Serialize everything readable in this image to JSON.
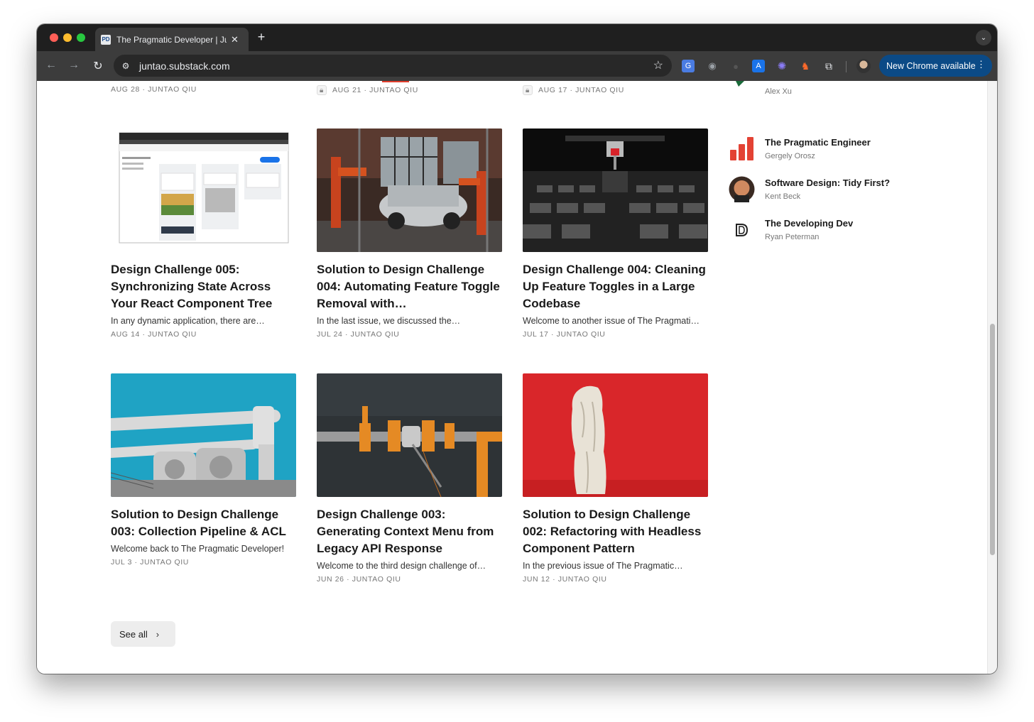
{
  "browser": {
    "tab_title": "The Pragmatic Developer | Ju",
    "tab_favicon": "PD",
    "url": "juntao.substack.com",
    "update_label": "New Chrome available"
  },
  "top_row": [
    {
      "meta": "AUG 28 · JUNTAO QIU",
      "locked": false
    },
    {
      "meta": "AUG 21 · JUNTAO QIU",
      "locked": true
    },
    {
      "meta": "AUG 17 · JUNTAO QIU",
      "locked": true
    }
  ],
  "posts": [
    {
      "title": "Design Challenge 005: Synchronizing State Across Your React Component Tree",
      "subtitle": "In any dynamic application, there are…",
      "meta": "AUG 14 · JUNTAO QIU",
      "image": "kanban-screenshot"
    },
    {
      "title": "Solution to Design Challenge 004: Automating Feature Toggle Removal with…",
      "subtitle": "In the last issue, we discussed the…",
      "meta": "JUL 24 · JUNTAO QIU",
      "image": "robot-assembly-line"
    },
    {
      "title": "Design Challenge 004: Cleaning Up Feature Toggles in a Large Codebase",
      "subtitle": "Welcome to another issue of The Pragmati…",
      "meta": "JUL 17 · JUNTAO QIU",
      "image": "circuit-board-printer"
    },
    {
      "title": "Solution to Design Challenge 003: Collection Pipeline & ACL",
      "subtitle": "Welcome back to The Pragmatic Developer!",
      "meta": "JUL 3 · JUNTAO QIU",
      "image": "industrial-pipes"
    },
    {
      "title": "Design Challenge 003: Generating Context Menu from Legacy API Response",
      "subtitle": "Welcome to the third design challenge of…",
      "meta": "JUN 26 · JUNTAO QIU",
      "image": "orange-gas-pipe"
    },
    {
      "title": "Solution to Design Challenge 002: Refactoring with Headless Component Pattern",
      "subtitle": "In the previous issue of The Pragmatic…",
      "meta": "JUN 12 · JUNTAO QIU",
      "image": "statue-red-wall"
    }
  ],
  "see_all_label": "See all",
  "recommendations": [
    {
      "name": "",
      "author": "Alex Xu",
      "icon": "bytebytego-logo"
    },
    {
      "name": "The Pragmatic Engineer",
      "author": "Gergely Orosz",
      "icon": "bar-chart-logo"
    },
    {
      "name": "Software Design: Tidy First?",
      "author": "Kent Beck",
      "icon": "kent-beck-avatar"
    },
    {
      "name": "The Developing Dev",
      "author": "Ryan Peterman",
      "icon": "developing-dev-logo"
    }
  ]
}
